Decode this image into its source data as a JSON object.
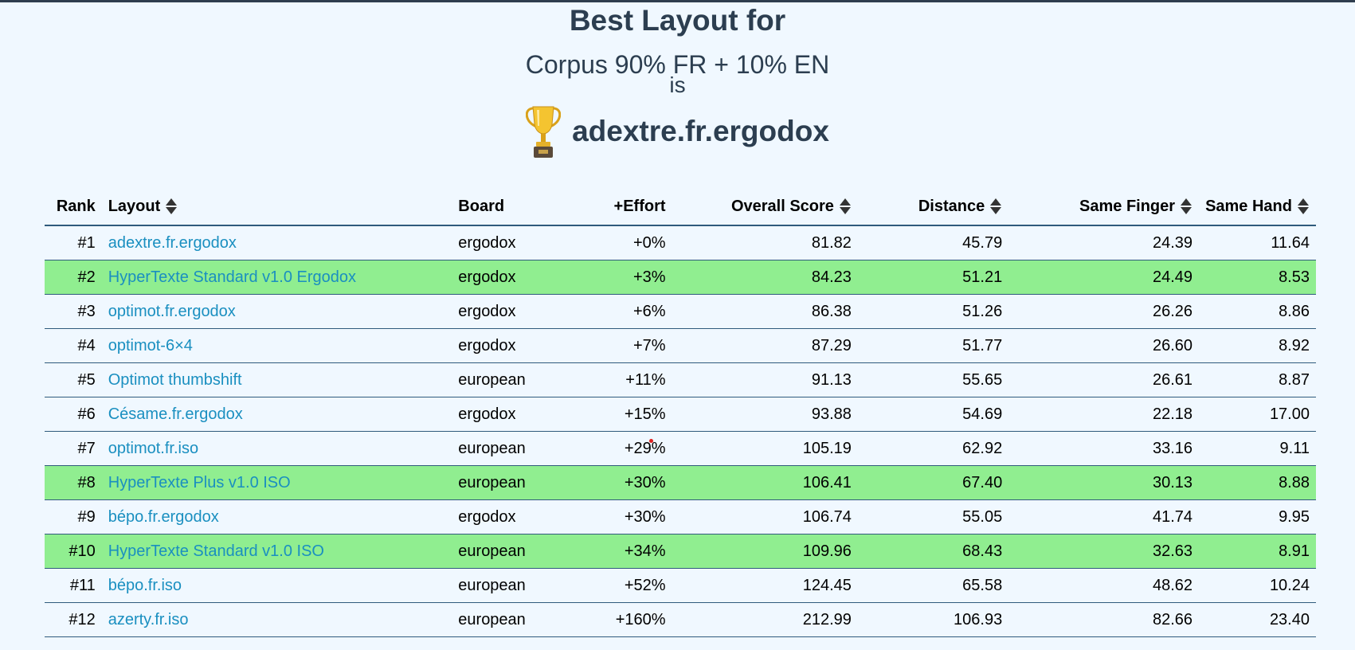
{
  "header": {
    "title": "Best Layout for",
    "corpus": "Corpus 90% FR + 10% EN",
    "is": "is",
    "winner": "adextre.fr.ergodox",
    "trophy_icon": "trophy-icon"
  },
  "table": {
    "columns": {
      "rank": "Rank",
      "layout": "Layout",
      "board": "Board",
      "effort": "+Effort",
      "overall": "Overall Score",
      "distance": "Distance",
      "same_finger": "Same Finger",
      "same_hand": "Same Hand"
    },
    "highlight_color": "#90ee90",
    "link_color": "#1a8fc0",
    "rows": [
      {
        "rank": "#1",
        "layout": "adextre.fr.ergodox",
        "board": "ergodox",
        "effort": "+0%",
        "overall": "81.82",
        "distance": "45.79",
        "same_finger": "24.39",
        "same_hand": "11.64",
        "highlight": false
      },
      {
        "rank": "#2",
        "layout": "HyperTexte Standard v1.0 Ergodox",
        "board": "ergodox",
        "effort": "+3%",
        "overall": "84.23",
        "distance": "51.21",
        "same_finger": "24.49",
        "same_hand": "8.53",
        "highlight": true
      },
      {
        "rank": "#3",
        "layout": "optimot.fr.ergodox",
        "board": "ergodox",
        "effort": "+6%",
        "overall": "86.38",
        "distance": "51.26",
        "same_finger": "26.26",
        "same_hand": "8.86",
        "highlight": false
      },
      {
        "rank": "#4",
        "layout": "optimot-6×4",
        "board": "ergodox",
        "effort": "+7%",
        "overall": "87.29",
        "distance": "51.77",
        "same_finger": "26.60",
        "same_hand": "8.92",
        "highlight": false
      },
      {
        "rank": "#5",
        "layout": "Optimot thumbshift",
        "board": "european",
        "effort": "+11%",
        "overall": "91.13",
        "distance": "55.65",
        "same_finger": "26.61",
        "same_hand": "8.87",
        "highlight": false
      },
      {
        "rank": "#6",
        "layout": "Césame.fr.ergodox",
        "board": "ergodox",
        "effort": "+15%",
        "overall": "93.88",
        "distance": "54.69",
        "same_finger": "22.18",
        "same_hand": "17.00",
        "highlight": false
      },
      {
        "rank": "#7",
        "layout": "optimot.fr.iso",
        "board": "european",
        "effort": "+29%",
        "overall": "105.19",
        "distance": "62.92",
        "same_finger": "33.16",
        "same_hand": "9.11",
        "highlight": false
      },
      {
        "rank": "#8",
        "layout": "HyperTexte Plus v1.0 ISO",
        "board": "european",
        "effort": "+30%",
        "overall": "106.41",
        "distance": "67.40",
        "same_finger": "30.13",
        "same_hand": "8.88",
        "highlight": true
      },
      {
        "rank": "#9",
        "layout": "bépo.fr.ergodox",
        "board": "ergodox",
        "effort": "+30%",
        "overall": "106.74",
        "distance": "55.05",
        "same_finger": "41.74",
        "same_hand": "9.95",
        "highlight": false
      },
      {
        "rank": "#10",
        "layout": "HyperTexte Standard v1.0 ISO",
        "board": "european",
        "effort": "+34%",
        "overall": "109.96",
        "distance": "68.43",
        "same_finger": "32.63",
        "same_hand": "8.91",
        "highlight": true
      },
      {
        "rank": "#11",
        "layout": "bépo.fr.iso",
        "board": "european",
        "effort": "+52%",
        "overall": "124.45",
        "distance": "65.58",
        "same_finger": "48.62",
        "same_hand": "10.24",
        "highlight": false
      },
      {
        "rank": "#12",
        "layout": "azerty.fr.iso",
        "board": "european",
        "effort": "+160%",
        "overall": "212.99",
        "distance": "106.93",
        "same_finger": "82.66",
        "same_hand": "23.40",
        "highlight": false
      }
    ]
  }
}
